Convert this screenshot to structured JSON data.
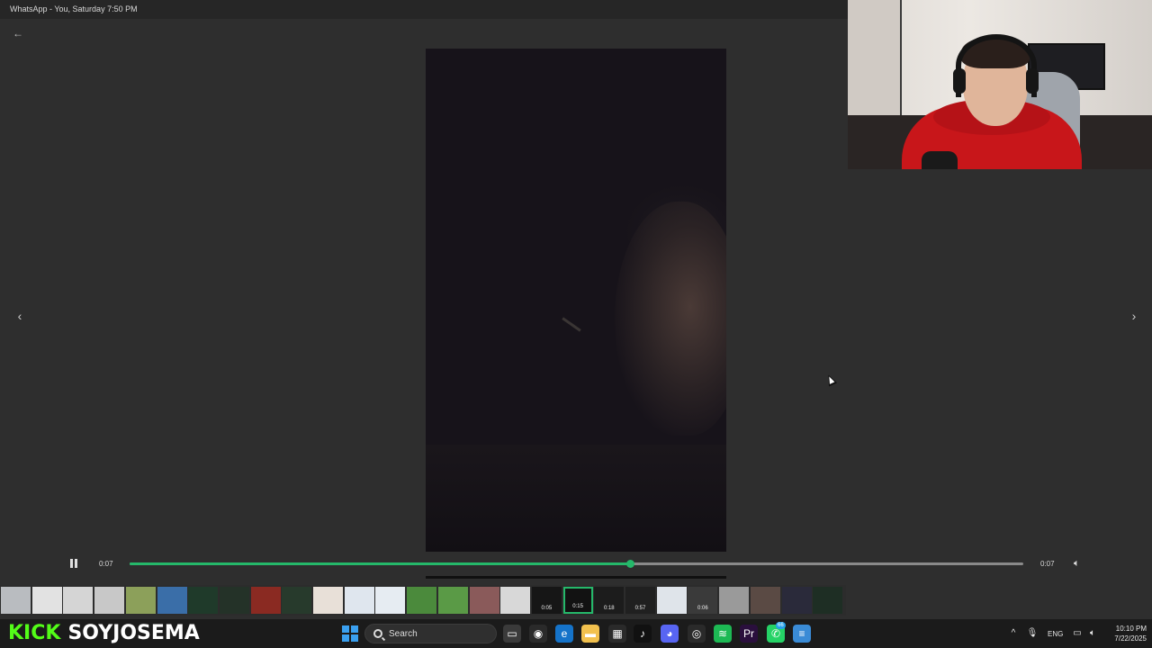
{
  "window": {
    "title": "WhatsApp - You, Saturday 7:50 PM"
  },
  "player": {
    "current_time": "0:07",
    "duration": "0:07",
    "progress": 0.56,
    "state": "playing"
  },
  "thumbnails": [
    {
      "duration": "",
      "color": "#b9bcc0"
    },
    {
      "duration": "",
      "color": "#e2e2e2"
    },
    {
      "duration": "",
      "color": "#d5d5d5"
    },
    {
      "duration": "",
      "color": "#c8c8c8"
    },
    {
      "duration": "",
      "color": "#8ca05a"
    },
    {
      "duration": "",
      "color": "#3a6ea8"
    },
    {
      "duration": "",
      "color": "#1f3a2a"
    },
    {
      "duration": "",
      "color": "#243228"
    },
    {
      "duration": "",
      "color": "#8a2a22"
    },
    {
      "duration": "",
      "color": "#273a2c"
    },
    {
      "duration": "",
      "color": "#e8e0d8"
    },
    {
      "duration": "",
      "color": "#dfe6ee"
    },
    {
      "duration": "",
      "color": "#e6ecf2"
    },
    {
      "duration": "",
      "color": "#4b8a3c"
    },
    {
      "duration": "",
      "color": "#5a9a46"
    },
    {
      "duration": "",
      "color": "#8a5a5a"
    },
    {
      "duration": "",
      "color": "#d8d8d8"
    },
    {
      "duration": "0:05",
      "color": "#161616"
    },
    {
      "duration": "0:15",
      "color": "#121212"
    },
    {
      "duration": "0:18",
      "color": "#1c1c1c"
    },
    {
      "duration": "0:57",
      "color": "#202020"
    },
    {
      "duration": "",
      "color": "#dfe4ea"
    },
    {
      "duration": "0:06",
      "color": "#3a3a3a"
    },
    {
      "duration": "",
      "color": "#9a9a9a"
    },
    {
      "duration": "",
      "color": "#5a4a44"
    },
    {
      "duration": "",
      "color": "#2a2a3a"
    },
    {
      "duration": "",
      "color": "#1e2e24"
    }
  ],
  "active_thumbnail_index": 18,
  "stream_overlay": {
    "platform": "KICK",
    "channel": "SOYJOSEMA"
  },
  "taskbar": {
    "search_placeholder": "Search",
    "language": "ENG",
    "time": "10:10 PM",
    "date": "7/22/2025",
    "whatsapp_badge": "66",
    "apps": [
      {
        "name": "task-view-icon",
        "glyph": "▭",
        "color": "#3a3a3a"
      },
      {
        "name": "obs-icon",
        "glyph": "◉",
        "color": "#2a2a2a"
      },
      {
        "name": "edge-icon",
        "glyph": "e",
        "color": "#1573c9"
      },
      {
        "name": "file-explorer-icon",
        "glyph": "▬",
        "color": "#f2c14e"
      },
      {
        "name": "microsoft-store-icon",
        "glyph": "▦",
        "color": "#2a2a2a"
      },
      {
        "name": "tiktok-icon",
        "glyph": "♪",
        "color": "#111111"
      },
      {
        "name": "discord-icon",
        "glyph": "◕",
        "color": "#5865f2"
      },
      {
        "name": "chrome-icon",
        "glyph": "◎",
        "color": "#2a2a2a"
      },
      {
        "name": "spotify-icon",
        "glyph": "≋",
        "color": "#1db954"
      },
      {
        "name": "premiere-icon",
        "glyph": "Pr",
        "color": "#2a0f3d"
      },
      {
        "name": "whatsapp-icon",
        "glyph": "✆",
        "color": "#25d366"
      },
      {
        "name": "notepad-icon",
        "glyph": "≡",
        "color": "#3a8bd6"
      }
    ]
  },
  "icons": {
    "back": "←",
    "prev": "‹",
    "next": "›",
    "volume": "🔈︎",
    "tray_up": "^",
    "mic": "🎙︎",
    "network": "▭",
    "speaker": "🔈︎"
  }
}
